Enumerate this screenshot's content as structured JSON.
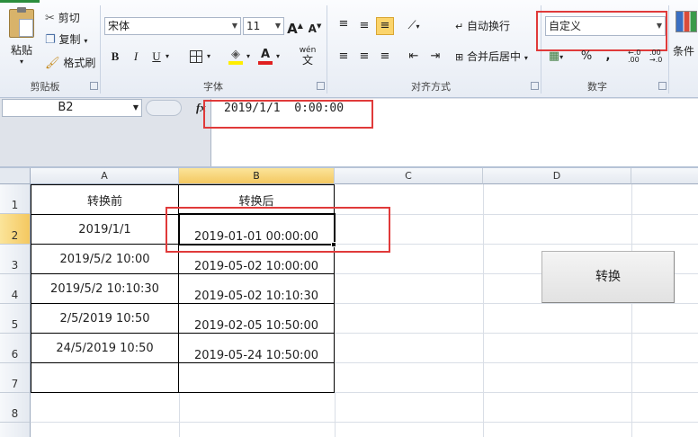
{
  "clipboard": {
    "paste": "粘贴",
    "cut": "剪切",
    "copy": "复制",
    "format_painter": "格式刷",
    "group_label": "剪贴板"
  },
  "font": {
    "name": "宋体",
    "size": "11",
    "bold": "B",
    "italic": "I",
    "underline": "U",
    "grow": "A",
    "shrink": "A",
    "pinyin": "wén",
    "group_label": "字体"
  },
  "alignment": {
    "wrap_text": "自动换行",
    "merge_center": "合并后居中",
    "group_label": "对齐方式"
  },
  "number": {
    "format": "自定义",
    "percent": "%",
    "comma": ",",
    "inc_decimal": ".00",
    "dec_decimal": ".00",
    "group_label": "数字"
  },
  "styles": {
    "conditional": "条件"
  },
  "formula_bar": {
    "name_box": "B2",
    "fx": "fx",
    "content": "2019/1/1  0:00:00"
  },
  "columns": [
    "A",
    "B",
    "C",
    "D"
  ],
  "rows": [
    "1",
    "2",
    "3",
    "4",
    "5",
    "6",
    "7",
    "8"
  ],
  "cells": {
    "A": [
      "转换前",
      "2019/1/1",
      "2019/5/2 10:00",
      "2019/5/2 10:10:30",
      "2/5/2019 10:50",
      "24/5/2019 10:50",
      ""
    ],
    "B": [
      "转换后",
      "2019-01-01 00:00:00",
      "2019-05-02 10:00:00",
      "2019-05-02 10:10:30",
      "2019-02-05 10:50:00",
      "2019-05-24 10:50:00",
      ""
    ]
  },
  "button": {
    "label": "转换"
  },
  "colors": {
    "highlight_box": "#e03a3a",
    "selected_header": "#f4c860",
    "ribbon_bg": "#e7ecf4"
  }
}
